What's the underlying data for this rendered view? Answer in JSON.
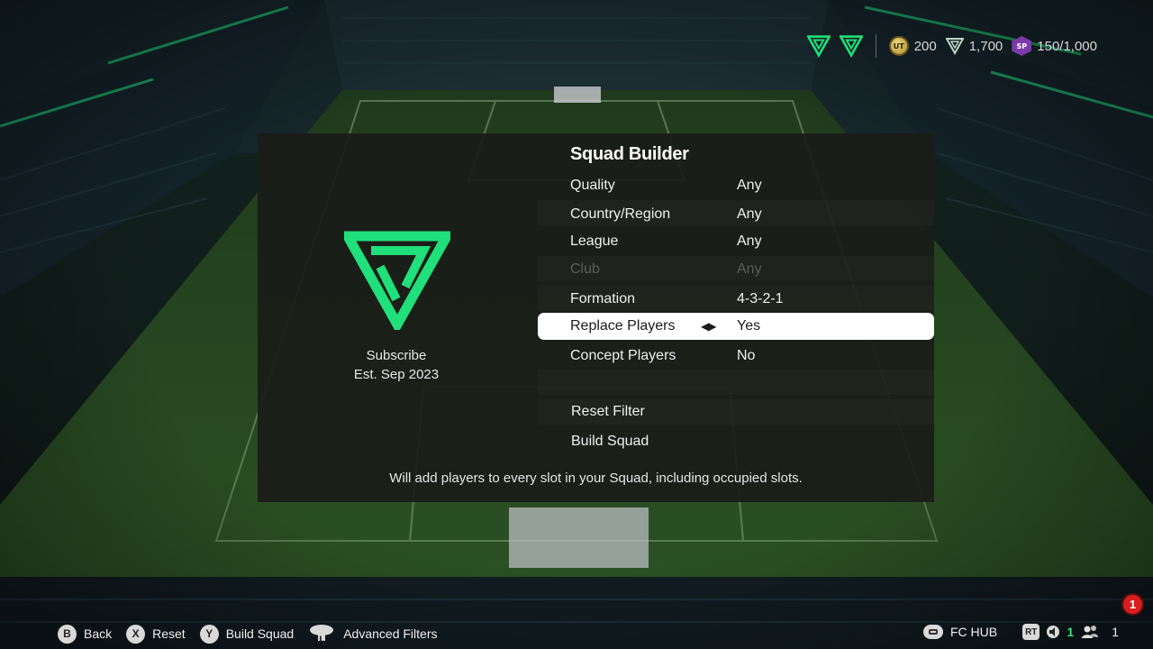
{
  "topbar": {
    "emblem_1": "fc-emblem-icon",
    "emblem_2": "fc-emblem-icon",
    "coins": "200",
    "coins_icon_text": "UT",
    "points": "1,700",
    "sp": "150/1,000",
    "sp_icon_text": "SP"
  },
  "panel": {
    "title": "Squad Builder",
    "club_lines": [
      "Subscribe",
      "Est. Sep 2023"
    ],
    "rows": [
      {
        "label": "Quality",
        "value": "Any"
      },
      {
        "label": "Country/Region",
        "value": "Any"
      },
      {
        "label": "League",
        "value": "Any"
      },
      {
        "label": "Club",
        "value": "Any",
        "disabled": true
      },
      {
        "label": "Formation",
        "value": "4-3-2-1"
      },
      {
        "label": "Replace Players",
        "value": "Yes",
        "selected": true
      },
      {
        "label": "Concept Players",
        "value": "No"
      }
    ],
    "actions": [
      "Reset Filter",
      "Build Squad"
    ],
    "hint": "Will add players to every slot in your Squad, including occupied slots."
  },
  "bottombar": {
    "buttons": [
      {
        "key": "B",
        "label": "Back"
      },
      {
        "key": "X",
        "label": "Reset"
      },
      {
        "key": "Y",
        "label": "Build Squad"
      },
      {
        "key": "left-stick",
        "label": "Advanced Filters"
      }
    ],
    "hub_label": "FC HUB",
    "rt_key": "RT",
    "voice_count": "1",
    "party_count": "1",
    "notification_count": "1"
  },
  "colors": {
    "accent_green": "#1fe07a",
    "panel_bg": "#1a1c18",
    "selected_row": "#ffffff",
    "notification": "#d81e1e"
  }
}
